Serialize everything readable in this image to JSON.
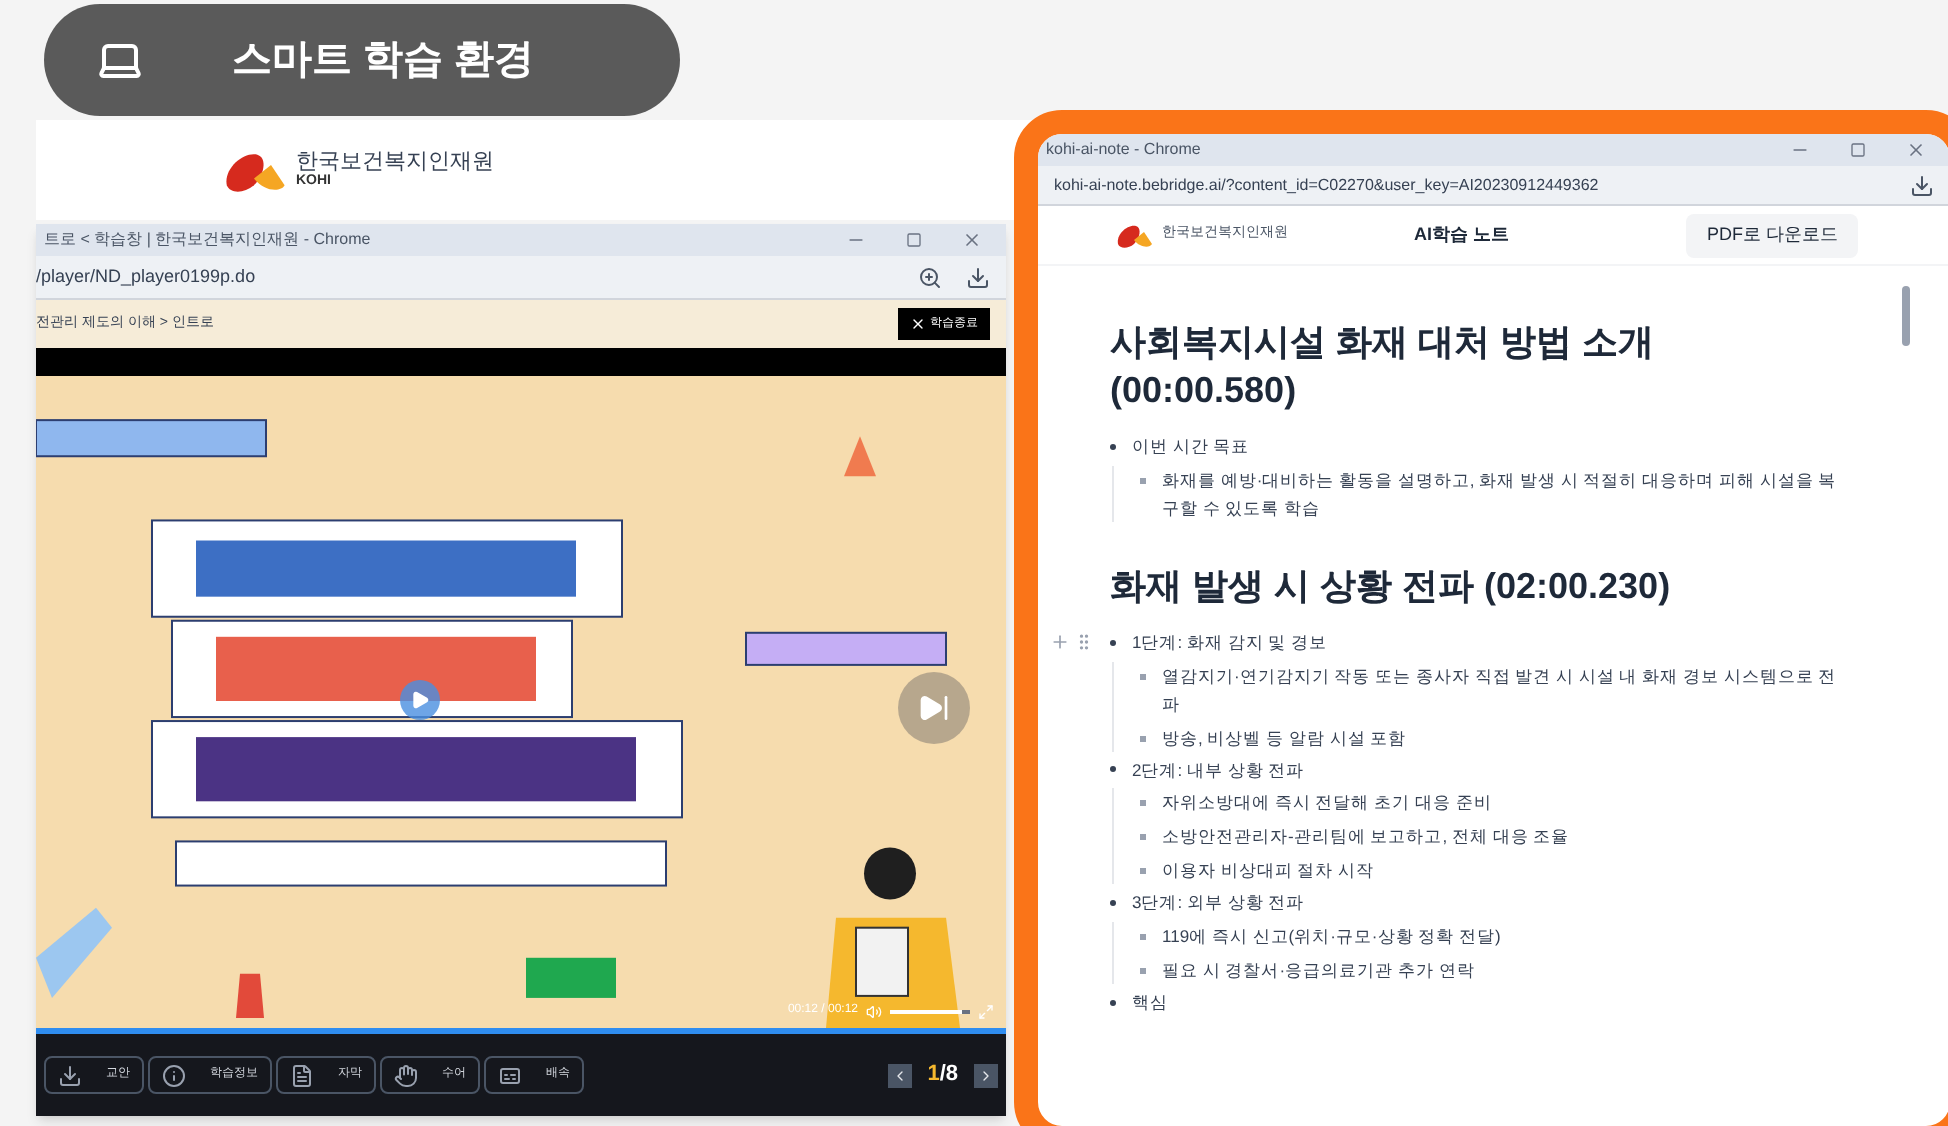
{
  "badge": {
    "label": "스마트 학습 환경"
  },
  "background_page": {
    "logo_name": "한국보건복지인재원",
    "logo_sub": "KOHI"
  },
  "player_window": {
    "title": "트로 < 학습창 | 한국보건복지인재원 - Chrome",
    "url": "/player/ND_player0199p.do",
    "breadcrumb": "전관리 제도의 이해 > 인트로",
    "exit_button": "학습종료",
    "seek": {
      "level": 1
    },
    "time": "00:12 / 00:12",
    "volume": {
      "level": 0.9
    },
    "tools": [
      {
        "kind": "download",
        "label": "교안"
      },
      {
        "kind": "info",
        "label": "학습정보"
      },
      {
        "kind": "subtitle",
        "label": "자막"
      },
      {
        "kind": "sign",
        "label": "수어"
      },
      {
        "kind": "speed",
        "label": "배속"
      }
    ],
    "page_current": "1",
    "page_total": "/8"
  },
  "note_window": {
    "title": "kohi-ai-note - Chrome",
    "url": "kohi-ai-note.bebridge.ai/?content_id=C02270&user_key=AI20230912449362",
    "logo_name": "한국보건복지인재원",
    "page_title": "AI학습 노트",
    "pdf_button": "PDF로 다운로드",
    "sections": [
      {
        "heading": "사회복지시설 화재 대처 방법 소개 (00:00.580)",
        "items": [
          {
            "text": "이번 시간 목표",
            "children": [
              {
                "text": "화재를 예방·대비하는 활동을 설명하고, 화재 발생 시 적절히 대응하며 피해 시설을 복구할 수 있도록 학습"
              }
            ]
          }
        ]
      },
      {
        "heading": "화재 발생 시 상황 전파 (02:00.230)",
        "items": [
          {
            "text": "1단계: 화재 감지 및 경보",
            "hovered": true,
            "children": [
              {
                "text": "열감지기·연기감지기 작동 또는 종사자 직접 발견 시 시설 내 화재 경보 시스템으로 전파"
              },
              {
                "text": "방송, 비상벨 등 알람 시설 포함"
              }
            ]
          },
          {
            "text": "2단계: 내부 상황 전파",
            "hovered": false,
            "children": [
              {
                "text": "자위소방대에 즉시 전달해 초기 대응 준비"
              },
              {
                "text": "소방안전관리자-관리팀에 보고하고, 전체 대응 조율"
              },
              {
                "text": "이용자 비상대피 절차 시작"
              }
            ]
          },
          {
            "text": "3단계: 외부 상황 전파",
            "hovered": false,
            "children": [
              {
                "text": "119에 즉시 신고(위치·규모·상황 정확 전달)"
              },
              {
                "text": "필요 시 경찰서·응급의료기관 추가 연락"
              }
            ]
          },
          {
            "text": "핵심",
            "hovered": false
          }
        ]
      }
    ]
  }
}
